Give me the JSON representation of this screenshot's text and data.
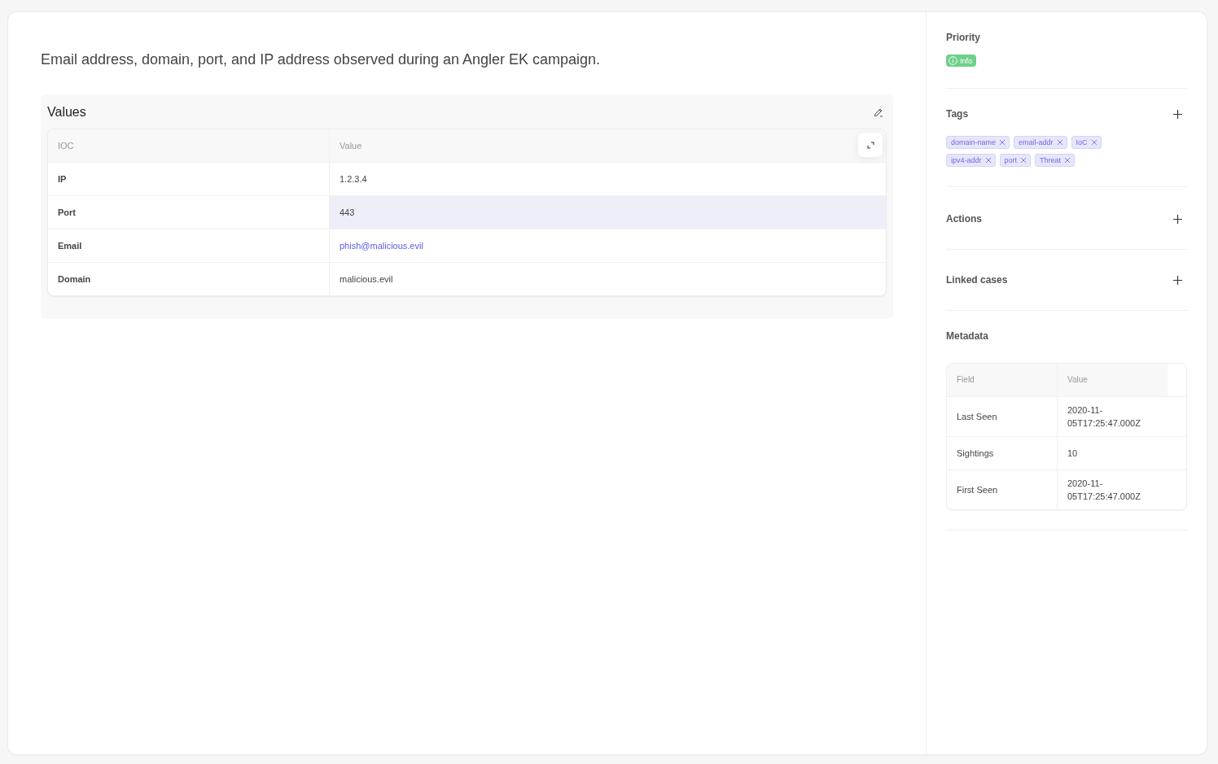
{
  "description": "Email address, domain, port, and IP address observed during an Angler EK campaign.",
  "values": {
    "title": "Values",
    "table": {
      "columns": [
        "IOC",
        "Value"
      ],
      "rows": [
        {
          "ioc": "IP",
          "value": "1.2.3.4",
          "kind": "text",
          "highlighted": false
        },
        {
          "ioc": "Port",
          "value": "443",
          "kind": "text",
          "highlighted": true
        },
        {
          "ioc": "Email",
          "value": "phish@malicious.evil",
          "kind": "link",
          "highlighted": false
        },
        {
          "ioc": "Domain",
          "value": "malicious.evil",
          "kind": "text",
          "highlighted": false
        }
      ]
    }
  },
  "sidebar": {
    "priority": {
      "title": "Priority",
      "badge": "Info",
      "color": "#6fd08c"
    },
    "tags": {
      "title": "Tags",
      "items": [
        "domain-name",
        "email-addr",
        "IoC",
        "ipv4-addr",
        "port",
        "Threat"
      ]
    },
    "actions": {
      "title": "Actions"
    },
    "linked_cases": {
      "title": "Linked cases"
    },
    "metadata": {
      "title": "Metadata",
      "columns": [
        "Field",
        "Value"
      ],
      "rows": [
        {
          "field": "Last Seen",
          "value": "2020-11-05T17:25:47.000Z"
        },
        {
          "field": "Sightings",
          "value": "10"
        },
        {
          "field": "First Seen",
          "value": "2020-11-05T17:25:47.000Z"
        }
      ]
    }
  }
}
